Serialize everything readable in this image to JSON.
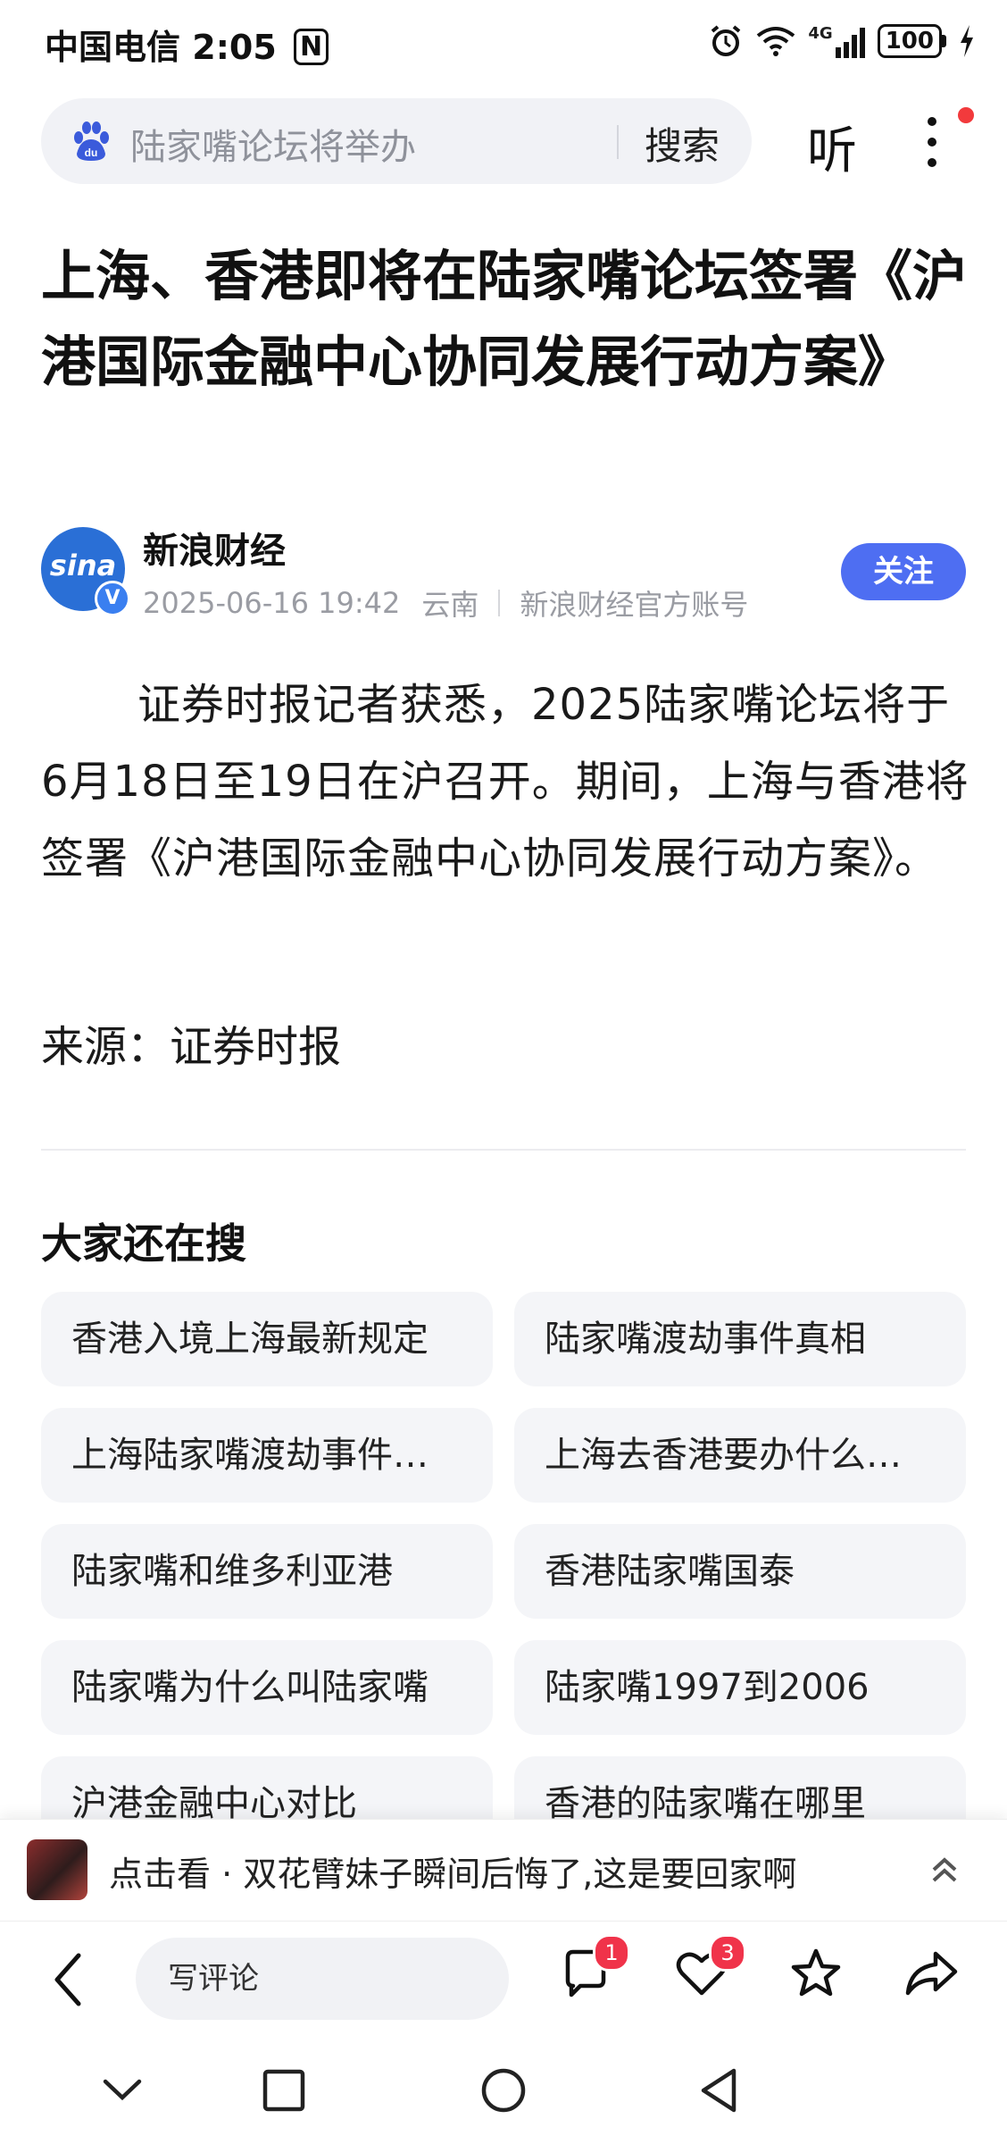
{
  "status_bar": {
    "carrier": "中国电信",
    "time": "2:05",
    "network": "4G",
    "battery": "100"
  },
  "search": {
    "query": "陆家嘴论坛将举办",
    "button": "搜索",
    "listen": "听",
    "brand_icon": "du"
  },
  "article": {
    "title": "上海、香港即将在陆家嘴论坛签署《沪港国际金融中心协同发展行动方案》",
    "author": {
      "avatar_text": "sina",
      "name": "新浪财经",
      "datetime": "2025-06-16 19:42",
      "location": "云南",
      "account_type": "新浪财经官方账号",
      "follow": "关注"
    },
    "body": "证券时报记者获悉，2025陆家嘴论坛将于6月18日至19日在沪召开。期间，上海与香港将签署《沪港国际金融中心协同发展行动方案》。",
    "source": "来源：证券时报"
  },
  "related": {
    "title": "大家还在搜",
    "items": [
      "香港入境上海最新规定",
      "陆家嘴渡劫事件真相",
      "上海陆家嘴渡劫事件…",
      "上海去香港要办什么…",
      "陆家嘴和维多利亚港",
      "香港陆家嘴国泰",
      "陆家嘴为什么叫陆家嘴",
      "陆家嘴1997到2006",
      "沪港金融中心对比",
      "香港的陆家嘴在哪里"
    ]
  },
  "recommendation": {
    "text": "点击看 · 双花臂妹子瞬间后悔了,这是要回家啊"
  },
  "action_bar": {
    "comment_placeholder": "写评论",
    "comment_count": "1",
    "like_count": "3"
  },
  "colors": {
    "accent": "#4e6ef2",
    "badge": "#f0334a",
    "notification_dot": "#f23a3c"
  }
}
